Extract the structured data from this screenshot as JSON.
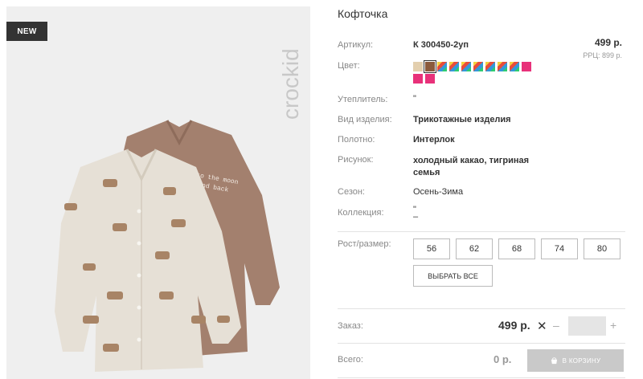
{
  "product": {
    "badge": "NEW",
    "brand": "crockid",
    "title": "Кофточка",
    "price": "499 р.",
    "rrp": "РРЦ: 899 р.",
    "print_text": "to the moon and back"
  },
  "attributes": {
    "sku": {
      "label": "Артикул:",
      "value": "К 300450-2уп"
    },
    "color": {
      "label": "Цвет:"
    },
    "insulation": {
      "label": "Утеплитель:",
      "value": "\""
    },
    "type": {
      "label": "Вид изделия:",
      "value": "Трикотажные изделия"
    },
    "fabric": {
      "label": "Полотно:",
      "value": "Интерлок"
    },
    "pattern": {
      "label": "Рисунок:",
      "value": "холодный какао, тигриная семья"
    },
    "season": {
      "label": "Сезон:",
      "value": "Осень-Зима"
    },
    "collection": {
      "label": "Коллекция:",
      "value": "\"\n–"
    }
  },
  "colors": {
    "swatches": [
      {
        "name": "beige",
        "fill": "#e3cfae"
      },
      {
        "name": "cocoa",
        "fill": "#8b5a3c",
        "selected": true
      },
      {
        "name": "multicolor",
        "fill": "multi"
      },
      {
        "name": "multicolor",
        "fill": "multi"
      },
      {
        "name": "multicolor",
        "fill": "multi"
      },
      {
        "name": "multicolor",
        "fill": "multi"
      },
      {
        "name": "multicolor",
        "fill": "multi"
      },
      {
        "name": "multicolor",
        "fill": "multi"
      },
      {
        "name": "multicolor",
        "fill": "multi"
      },
      {
        "name": "pink",
        "fill": "#e8317a"
      },
      {
        "name": "pink",
        "fill": "#e8317a"
      },
      {
        "name": "pink",
        "fill": "#e8317a"
      }
    ]
  },
  "sizes": {
    "label": "Рост/размер:",
    "options": [
      "56",
      "62",
      "68",
      "74",
      "80"
    ],
    "select_all": "ВЫБРАТЬ ВСЕ"
  },
  "order": {
    "label": "Заказ:",
    "price": "499 р.",
    "times": "✕",
    "minus": "–",
    "plus": "+",
    "quantity": ""
  },
  "total": {
    "label": "Всего:",
    "value": "0 р.",
    "cart_button": "В КОРЗИНУ"
  },
  "theme": {
    "badge_bg": "#333333",
    "panel_bg": "#efefef",
    "cart_disabled": "#c9c9c9"
  }
}
